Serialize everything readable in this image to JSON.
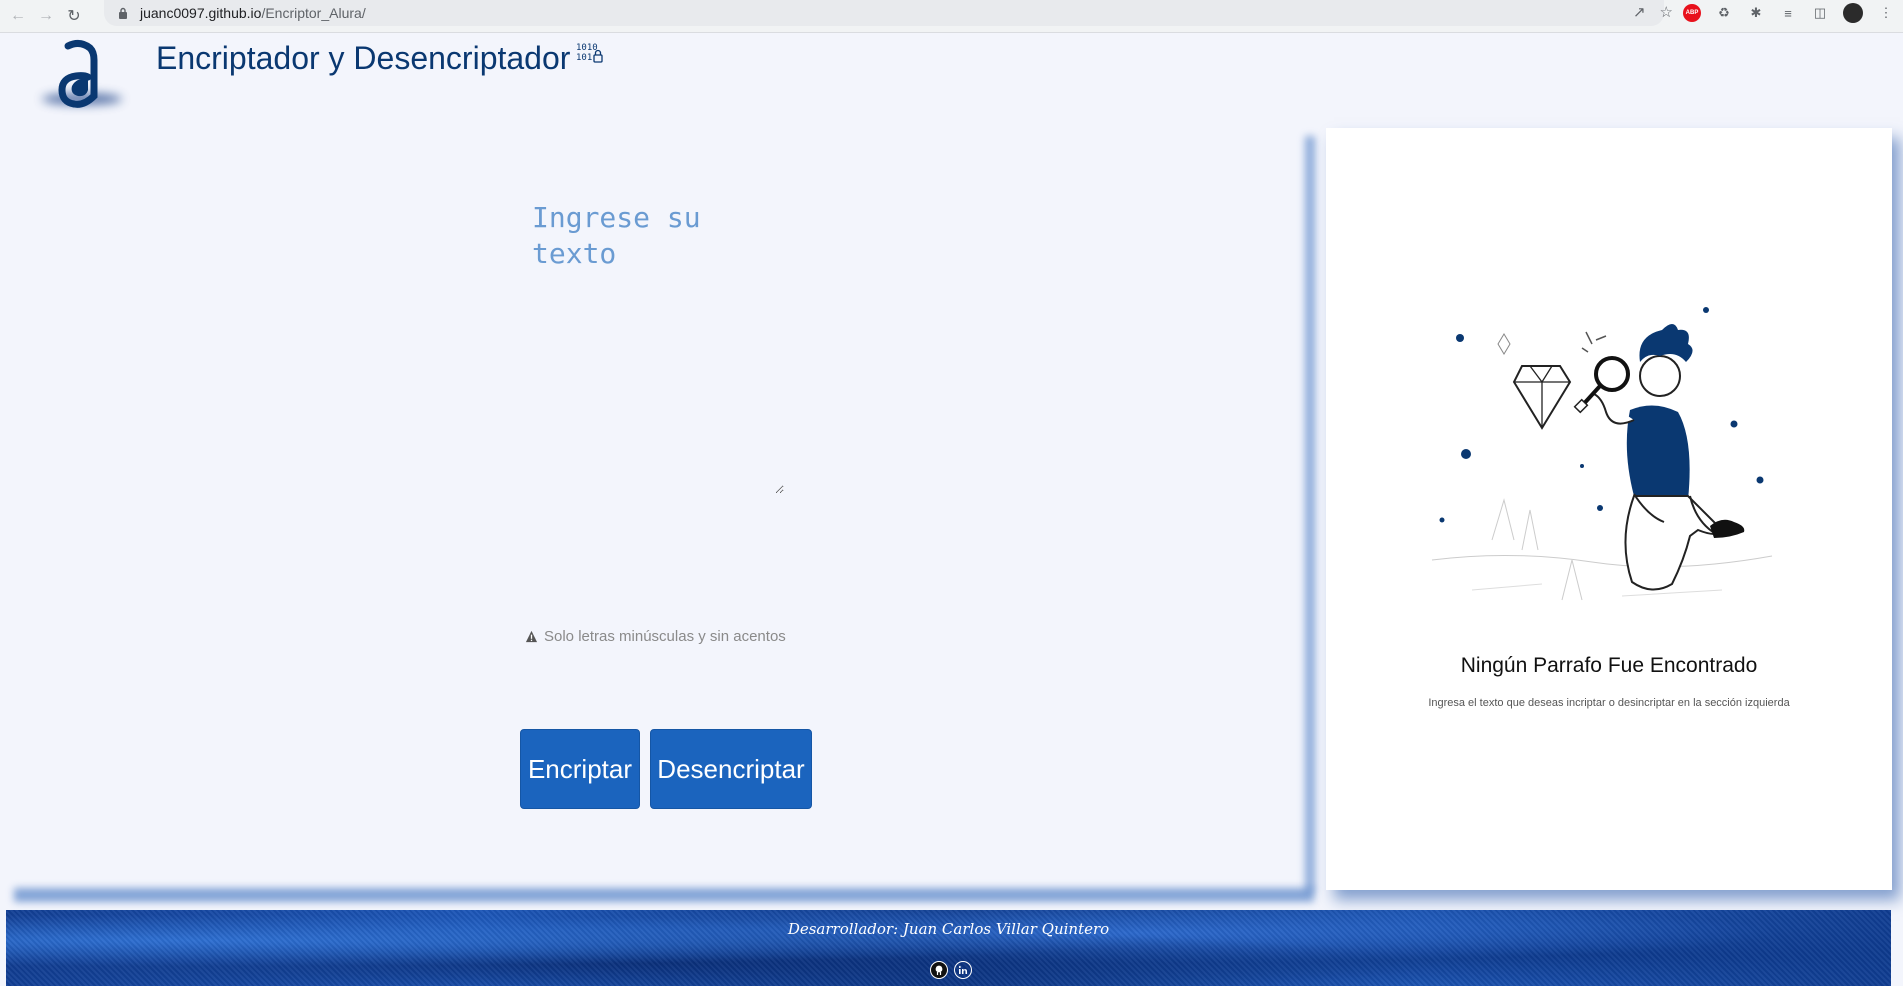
{
  "browser": {
    "url_host": "juanc0097.github.io",
    "url_path": "/Encriptor_Alura/"
  },
  "header": {
    "title": "Encriptador y Desencriptador"
  },
  "input": {
    "placeholder": "Ingrese su texto",
    "value": ""
  },
  "hint": {
    "text": "Solo letras minúsculas y sin acentos"
  },
  "buttons": {
    "encrypt": "Encriptar",
    "decrypt": "Desencriptar"
  },
  "output_card": {
    "title": "Ningún Parrafo Fue Encontrado",
    "subtitle": "Ingresa el texto que deseas incriptar o desincriptar en la sección izquierda"
  },
  "footer": {
    "credit": "Desarrollador: Juan Carlos Villar Quintero"
  },
  "colors": {
    "primary": "#0a3871",
    "button": "#1b64be",
    "background": "#f3f5fc",
    "placeholder": "#6a9bd2"
  },
  "icons": [
    "back-arrow-icon",
    "forward-arrow-icon",
    "reload-icon",
    "lock-icon",
    "share-icon",
    "star-icon",
    "adblock-icon",
    "extension-icon",
    "puzzle-icon",
    "reading-list-icon",
    "side-panel-icon",
    "profile-avatar",
    "binary-lock-icon",
    "warning-icon",
    "github-icon",
    "linkedin-icon"
  ]
}
